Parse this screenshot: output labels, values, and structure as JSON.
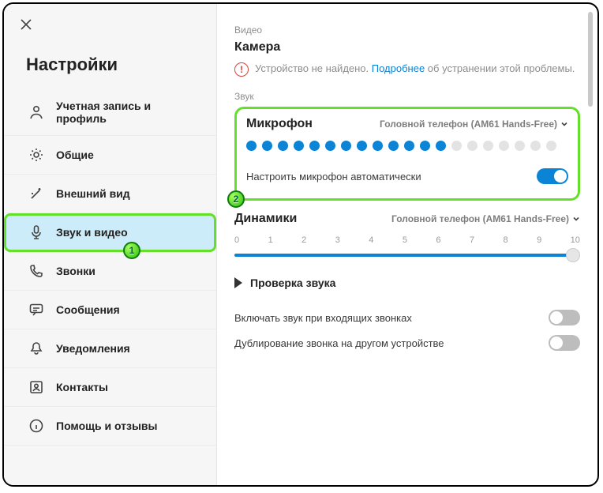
{
  "sidebar": {
    "title": "Настройки",
    "items": [
      {
        "label": "Учетная запись и профиль"
      },
      {
        "label": "Общие"
      },
      {
        "label": "Внешний вид"
      },
      {
        "label": "Звук и видео"
      },
      {
        "label": "Звонки"
      },
      {
        "label": "Сообщения"
      },
      {
        "label": "Уведомления"
      },
      {
        "label": "Контакты"
      },
      {
        "label": "Помощь и отзывы"
      }
    ]
  },
  "main": {
    "video_section": "Видео",
    "camera_title": "Камера",
    "camera_err_pre": "Устройство не найдено. ",
    "camera_err_link": "Подробнее",
    "camera_err_post": " об устранении этой проблемы.",
    "sound_section": "Звук",
    "mic_title": "Микрофон",
    "mic_device": "Головной телефон (AM61 Hands-Free)",
    "mic_level_active": 13,
    "mic_level_total": 20,
    "mic_auto_label": "Настроить микрофон автоматически",
    "mic_auto_on": true,
    "speakers_title": "Динамики",
    "speakers_device": "Головной телефон (AM61 Hands-Free)",
    "slider_ticks": [
      "0",
      "1",
      "2",
      "3",
      "4",
      "5",
      "6",
      "7",
      "8",
      "9",
      "10"
    ],
    "slider_value": 10,
    "test_label": "Проверка звука",
    "ring_inc_label": "Включать звук при входящих звонках",
    "ring_inc_on": false,
    "ring_dup_label": "Дублирование звонка на другом устройстве",
    "ring_dup_on": false
  },
  "callouts": {
    "one": "1",
    "two": "2"
  }
}
